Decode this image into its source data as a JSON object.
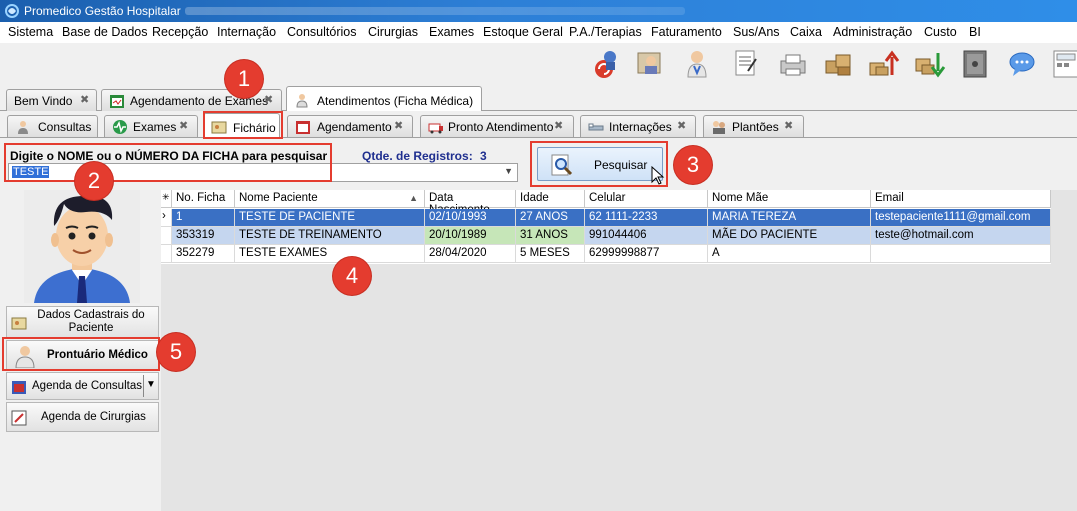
{
  "window": {
    "title": "Promedico Gestão Hospitalar"
  },
  "menu": [
    "Sistema",
    "Base de Dados",
    "Recepção",
    "Internação",
    "Consultórios",
    "Cirurgias",
    "Exames",
    "Estoque Geral",
    "P.A./Terapias",
    "Faturamento",
    "Sus/Ans",
    "Caixa",
    "Administração",
    "Custo",
    "BI"
  ],
  "toolbar_icons": [
    "refresh-icon",
    "reception-icon",
    "doctor-icon",
    "document-icon",
    "printer-icon",
    "inventory-icon",
    "stock-up-icon",
    "stock-down-icon",
    "safe-icon",
    "chat-icon",
    "calculator-icon"
  ],
  "top_tabs": [
    {
      "label": "Bem Vindo"
    },
    {
      "label": "Agendamento de Exames"
    },
    {
      "label": "Atendimentos (Ficha Médica)"
    }
  ],
  "sub_tabs": [
    {
      "label": "Consultas"
    },
    {
      "label": "Exames"
    },
    {
      "label": "Fichário"
    },
    {
      "label": "Agendamento"
    },
    {
      "label": "Pronto Atendimento"
    },
    {
      "label": "Internações"
    },
    {
      "label": "Plantões"
    }
  ],
  "search": {
    "prompt": "Digite o NOME ou o NÚMERO DA FICHA para pesquisar",
    "value": "TESTE",
    "count_label": "Qtde. de Registros:",
    "count_value": "3",
    "button_label": "Pesquisar"
  },
  "side_buttons": {
    "dados": "Dados Cadastrais do Paciente",
    "prontuario": "Prontuário Médico",
    "agenda_consultas": "Agenda de Consultas",
    "agenda_cirurgias": "Agenda de Cirurgias"
  },
  "table": {
    "headers": [
      "No. Ficha",
      "Nome Paciente",
      "Data Nascimento",
      "Idade",
      "Celular",
      "Nome Mãe",
      "Email"
    ],
    "rows": [
      [
        "1",
        "TESTE DE PACIENTE",
        "02/10/1993",
        "27 ANOS",
        "62 1111-2233",
        "MARIA TEREZA",
        "testepaciente1111@gmail.com"
      ],
      [
        "353319",
        "TESTE DE TREINAMENTO",
        "20/10/1989",
        "31 ANOS",
        "991044406",
        "MÃE DO PACIENTE",
        "teste@hotmail.com"
      ],
      [
        "352279",
        "TESTE EXAMES",
        "28/04/2020",
        "5 MESES",
        "62999998877",
        "A",
        ""
      ]
    ]
  },
  "badges": [
    "1",
    "2",
    "3",
    "4",
    "5"
  ],
  "colors": {
    "badge": "#e43c2f",
    "selection": "#3a70c4",
    "title_bar": "#2d7fd6"
  }
}
